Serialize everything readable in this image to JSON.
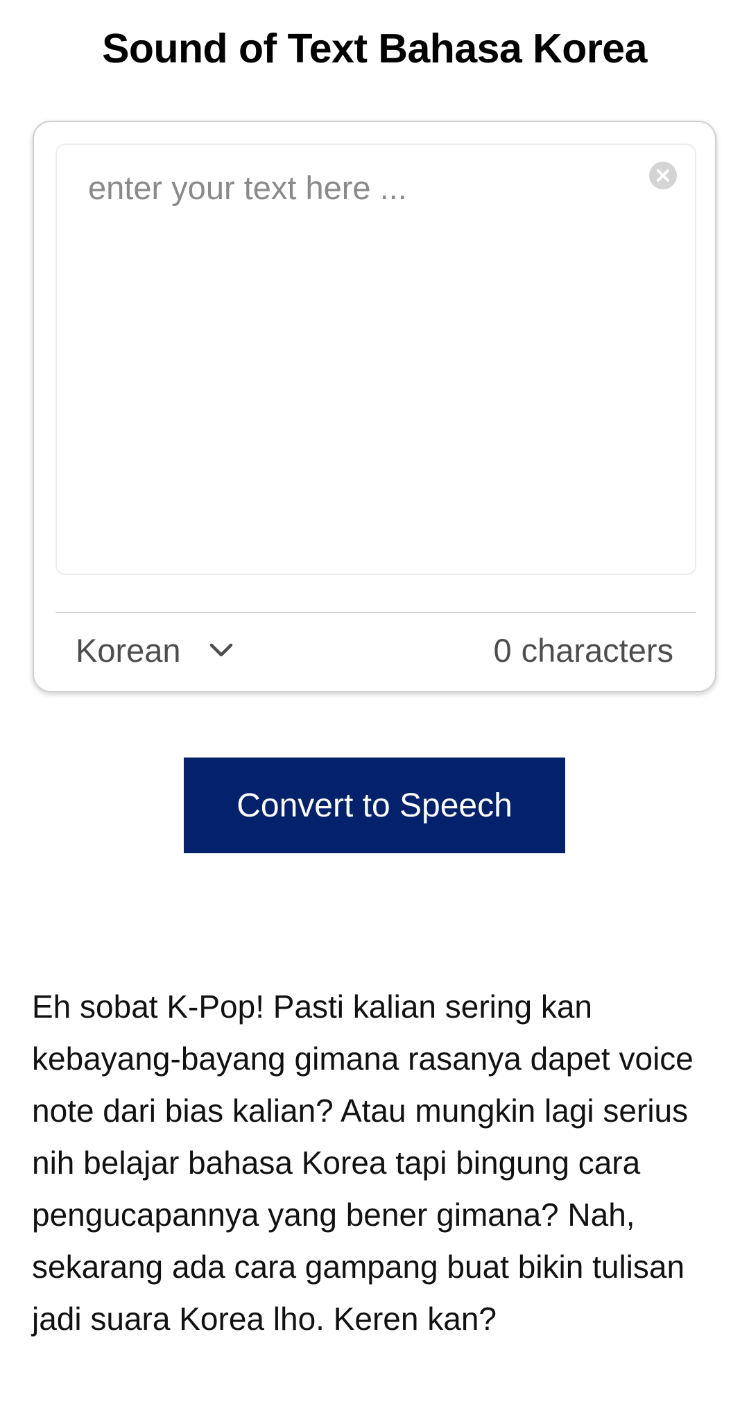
{
  "header": {
    "title": "Sound of Text Bahasa Korea"
  },
  "editor": {
    "placeholder": "enter your text here ...",
    "value": "",
    "clear_icon": "close-circle-icon",
    "language": "Korean",
    "language_icon": "chevron-down-icon",
    "char_count": "0",
    "char_label": "characters"
  },
  "actions": {
    "convert_label": "Convert to Speech"
  },
  "content": {
    "intro": "Eh sobat K-Pop! Pasti kalian sering kan kebayang-bayang gimana rasanya dapet voice note dari bias kalian? Atau mungkin lagi serius nih belajar bahasa Korea tapi bingung cara pengucapannya yang bener gimana? Nah, sekarang ada cara gampang buat bikin tulisan jadi suara Korea lho. Keren kan?"
  },
  "colors": {
    "primary_button": "#03226b",
    "card_border": "#cfcfcf",
    "muted_text": "#4d4d4d"
  }
}
